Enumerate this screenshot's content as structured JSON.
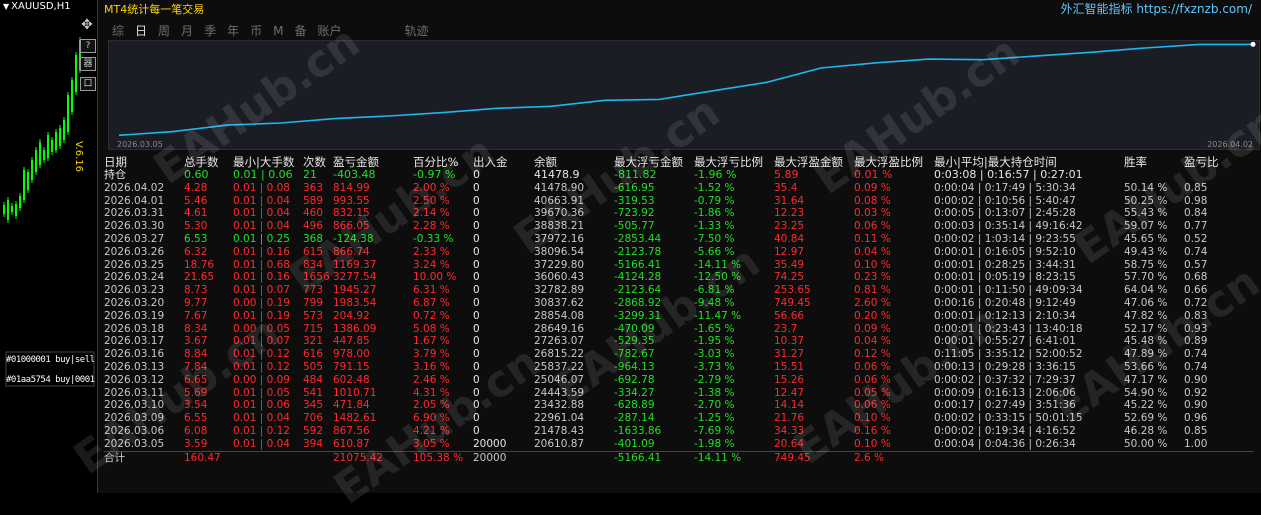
{
  "chart_window": {
    "symbol_title": "XAUUSD,H1",
    "price_label": "V.6.16",
    "icon_labels": [
      "?",
      "器",
      "口"
    ],
    "garbled_texts": [
      "#01000001 buy|sell",
      "#01aa5754 buy|0001"
    ]
  },
  "panel": {
    "title": "MT4统计每一笔交易",
    "brand": "外汇智能指标 https://fxznzb.com/",
    "tabs": [
      "综",
      "日",
      "周",
      "月",
      "季",
      "年",
      "币",
      "M",
      "备",
      "账户",
      "轨迹"
    ],
    "active_tab": 1,
    "watermark": "EAHub.cn"
  },
  "chart_data": {
    "type": "line",
    "start_label": "2026.03.05",
    "end_label": "2026.04.02",
    "x": [
      "2026.03.05",
      "2026.03.06",
      "2026.03.09",
      "2026.03.10",
      "2026.03.11",
      "2026.03.12",
      "2026.03.13",
      "2026.03.16",
      "2026.03.17",
      "2026.03.18",
      "2026.03.19",
      "2026.03.20",
      "2026.03.23",
      "2026.03.24",
      "2026.03.25",
      "2026.03.26",
      "2026.03.27",
      "2026.03.30",
      "2026.03.31",
      "2026.04.01",
      "2026.04.02",
      "持仓"
    ],
    "y": [
      20610.87,
      21478.43,
      22961.04,
      23432.88,
      24443.59,
      25046.07,
      25837.22,
      26815.22,
      27263.07,
      28649.16,
      28854.08,
      30837.62,
      32782.89,
      36060.43,
      37229.8,
      38096.54,
      37972.16,
      38838.21,
      39670.36,
      40663.91,
      41478.9,
      41478.9
    ],
    "series": [
      {
        "color": "#1fb6f0"
      }
    ]
  },
  "table": {
    "headers": [
      "日期",
      "总手数",
      "最小|大手数",
      "次数",
      "盈亏金额",
      "百分比%",
      "出入金",
      "余额",
      "最大浮亏金额",
      "最大浮亏比例",
      "最大浮盈金额",
      "最大浮盈比例",
      "最小|平均|最大持仓时间",
      "胜率",
      "盈亏比"
    ],
    "holding": [
      "持仓",
      "0.60",
      "0.01 | 0.06",
      "21",
      "-403.48",
      "-0.97 %",
      "0",
      "41478.9",
      "-811.82",
      "-1.96 %",
      "5.89",
      "0.01 %",
      "0:03:08 | 0:16:57 | 0:27:01",
      "",
      ""
    ],
    "rows": [
      [
        "2026.04.02",
        "4.28",
        "0.01 | 0.08",
        "363",
        "814.99",
        "2.00 %",
        "0",
        "41478.90",
        "-616.95",
        "-1.52 %",
        "35.4",
        "0.09 %",
        "0:00:04 | 0:17:49 | 5:30:34",
        "50.14 %",
        "0.85"
      ],
      [
        "2026.04.01",
        "5.46",
        "0.01 | 0.04",
        "589",
        "993.55",
        "2.50 %",
        "0",
        "40663.91",
        "-319.53",
        "-0.79 %",
        "31.64",
        "0.08 %",
        "0:00:02 | 0:10:56 | 5:40:47",
        "50.25 %",
        "0.98"
      ],
      [
        "2026.03.31",
        "4.61",
        "0.01 | 0.04",
        "460",
        "832.15",
        "2.14 %",
        "0",
        "39670.36",
        "-723.92",
        "-1.86 %",
        "12.23",
        "0.03 %",
        "0:00:05 | 0:13:07 | 2:45:28",
        "55.43 %",
        "0.84"
      ],
      [
        "2026.03.30",
        "5.30",
        "0.01 | 0.04",
        "496",
        "866.05",
        "2.28 %",
        "0",
        "38838.21",
        "-505.77",
        "-1.33 %",
        "23.25",
        "0.06 %",
        "0:00:03 | 0:35:14 | 49:16:42",
        "59.07 %",
        "0.77"
      ],
      [
        "2026.03.27",
        "6.53",
        "0.01 | 0.25",
        "368",
        "-124.38",
        "-0.33 %",
        "0",
        "37972.16",
        "-2853.44",
        "-7.50 %",
        "40.84",
        "0.11 %",
        "0:00:02 | 1:03:14 | 9:23:55",
        "45.65 %",
        "0.52"
      ],
      [
        "2026.03.26",
        "6.32",
        "0.01 | 0.16",
        "615",
        "866.74",
        "2.33 %",
        "0",
        "38096.54",
        "-2123.78",
        "-5.66 %",
        "12.97",
        "0.04 %",
        "0:00:01 | 0:16:05 | 9:52:10",
        "49.43 %",
        "0.74"
      ],
      [
        "2026.03.25",
        "18.76",
        "0.01 | 0.68",
        "834",
        "1169.37",
        "3.24 %",
        "0",
        "37229.80",
        "-5166.41",
        "-14.11 %",
        "35.49",
        "0.10 %",
        "0:00:01 | 0:28:25 | 3:44:31",
        "58.75 %",
        "0.57"
      ],
      [
        "2026.03.24",
        "21.65",
        "0.01 | 0.16",
        "1656",
        "3277.54",
        "10.00 %",
        "0",
        "36060.43",
        "-4124.28",
        "-12.50 %",
        "74.25",
        "0.23 %",
        "0:00:01 | 0:05:19 | 8:23:15",
        "57.70 %",
        "0.68"
      ],
      [
        "2026.03.23",
        "8.73",
        "0.01 | 0.07",
        "773",
        "1945.27",
        "6.31 %",
        "0",
        "32782.89",
        "-2123.64",
        "-6.81 %",
        "253.65",
        "0.81 %",
        "0:00:01 | 0:11:50 | 49:09:34",
        "64.04 %",
        "0.66"
      ],
      [
        "2026.03.20",
        "9.77",
        "0.00 | 0.19",
        "799",
        "1983.54",
        "6.87 %",
        "0",
        "30837.62",
        "-2868.92",
        "-9.48 %",
        "749.45",
        "2.60 %",
        "0:00:16 | 0:20:48 | 9:12:49",
        "47.06 %",
        "0.72"
      ],
      [
        "2026.03.19",
        "7.67",
        "0.01 | 0.19",
        "573",
        "204.92",
        "0.72 %",
        "0",
        "28854.08",
        "-3299.31",
        "-11.47 %",
        "56.66",
        "0.20 %",
        "0:00:01 | 0:12:13 | 2:10:34",
        "47.82 %",
        "0.83"
      ],
      [
        "2026.03.18",
        "8.34",
        "0.00 | 0.05",
        "715",
        "1386.09",
        "5.08 %",
        "0",
        "28649.16",
        "-470.09",
        "-1.65 %",
        "23.7",
        "0.09 %",
        "0:00:01 | 0:23:43 | 13:40:18",
        "52.17 %",
        "0.93"
      ],
      [
        "2026.03.17",
        "3.67",
        "0.01 | 0.07",
        "321",
        "447.85",
        "1.67 %",
        "0",
        "27263.07",
        "-529.35",
        "-1.95 %",
        "10.37",
        "0.04 %",
        "0:00:01 | 0:55:27 | 6:41:01",
        "45.48 %",
        "0.89"
      ],
      [
        "2026.03.16",
        "8.84",
        "0.01 | 0.12",
        "616",
        "978.00",
        "3.79 %",
        "0",
        "26815.22",
        "-782.67",
        "-3.03 %",
        "31.27",
        "0.12 %",
        "0:11:05 | 3:35:12 | 52:00:52",
        "47.89 %",
        "0.74"
      ],
      [
        "2026.03.13",
        "7.84",
        "0.01 | 0.12",
        "505",
        "791.15",
        "3.16 %",
        "0",
        "25837.22",
        "-964.13",
        "-3.73 %",
        "15.51",
        "0.06 %",
        "0:00:13 | 0:29:28 | 3:36:15",
        "53.66 %",
        "0.74"
      ],
      [
        "2026.03.12",
        "6.65",
        "0.00 | 0.09",
        "484",
        "602.48",
        "2.46 %",
        "0",
        "25046.07",
        "-692.78",
        "-2.79 %",
        "15.26",
        "0.06 %",
        "0:00:02 | 0:37:32 | 7:29:37",
        "47.17 %",
        "0.90"
      ],
      [
        "2026.03.11",
        "5.69",
        "0.01 | 0.05",
        "541",
        "1010.71",
        "4.31 %",
        "0",
        "24443.59",
        "-334.27",
        "-1.38 %",
        "12.47",
        "0.05 %",
        "0:00:09 | 0:16:13 | 2:06:06",
        "54.90 %",
        "0.92"
      ],
      [
        "2026.03.10",
        "3.54",
        "0.01 | 0.06",
        "345",
        "471.84",
        "2.05 %",
        "0",
        "23432.88",
        "-628.89",
        "-2.70 %",
        "14.14",
        "0.06 %",
        "0:00:17 | 0:27:49 | 3:51:36",
        "45.22 %",
        "0.90"
      ],
      [
        "2026.03.09",
        "6.55",
        "0.01 | 0.04",
        "706",
        "1482.61",
        "6.90 %",
        "0",
        "22961.04",
        "-287.14",
        "-1.25 %",
        "21.76",
        "0.10 %",
        "0:00:02 | 0:33:15 | 50:01:15",
        "52.69 %",
        "0.96"
      ],
      [
        "2026.03.06",
        "6.08",
        "0.01 | 0.12",
        "592",
        "867.56",
        "4.21 %",
        "0",
        "21478.43",
        "-1633.86",
        "-7.69 %",
        "34.33",
        "0.16 %",
        "0:00:02 | 0:19:34 | 4:16:52",
        "46.28 %",
        "0.85"
      ],
      [
        "2026.03.05",
        "3.59",
        "0.01 | 0.04",
        "394",
        "610.87",
        "3.05 %",
        "20000",
        "20610.87",
        "-401.09",
        "-1.98 %",
        "20.64",
        "0.10 %",
        "0:00:04 | 0:04:36 | 0:26:34",
        "50.00 %",
        "1.00"
      ]
    ],
    "total": [
      "合计",
      "160.47",
      "",
      "",
      "21075.42",
      "105.38 %",
      "20000",
      "",
      "-5166.41",
      "-14.11 %",
      "749.45",
      "2.6 %",
      "",
      "",
      ""
    ]
  }
}
